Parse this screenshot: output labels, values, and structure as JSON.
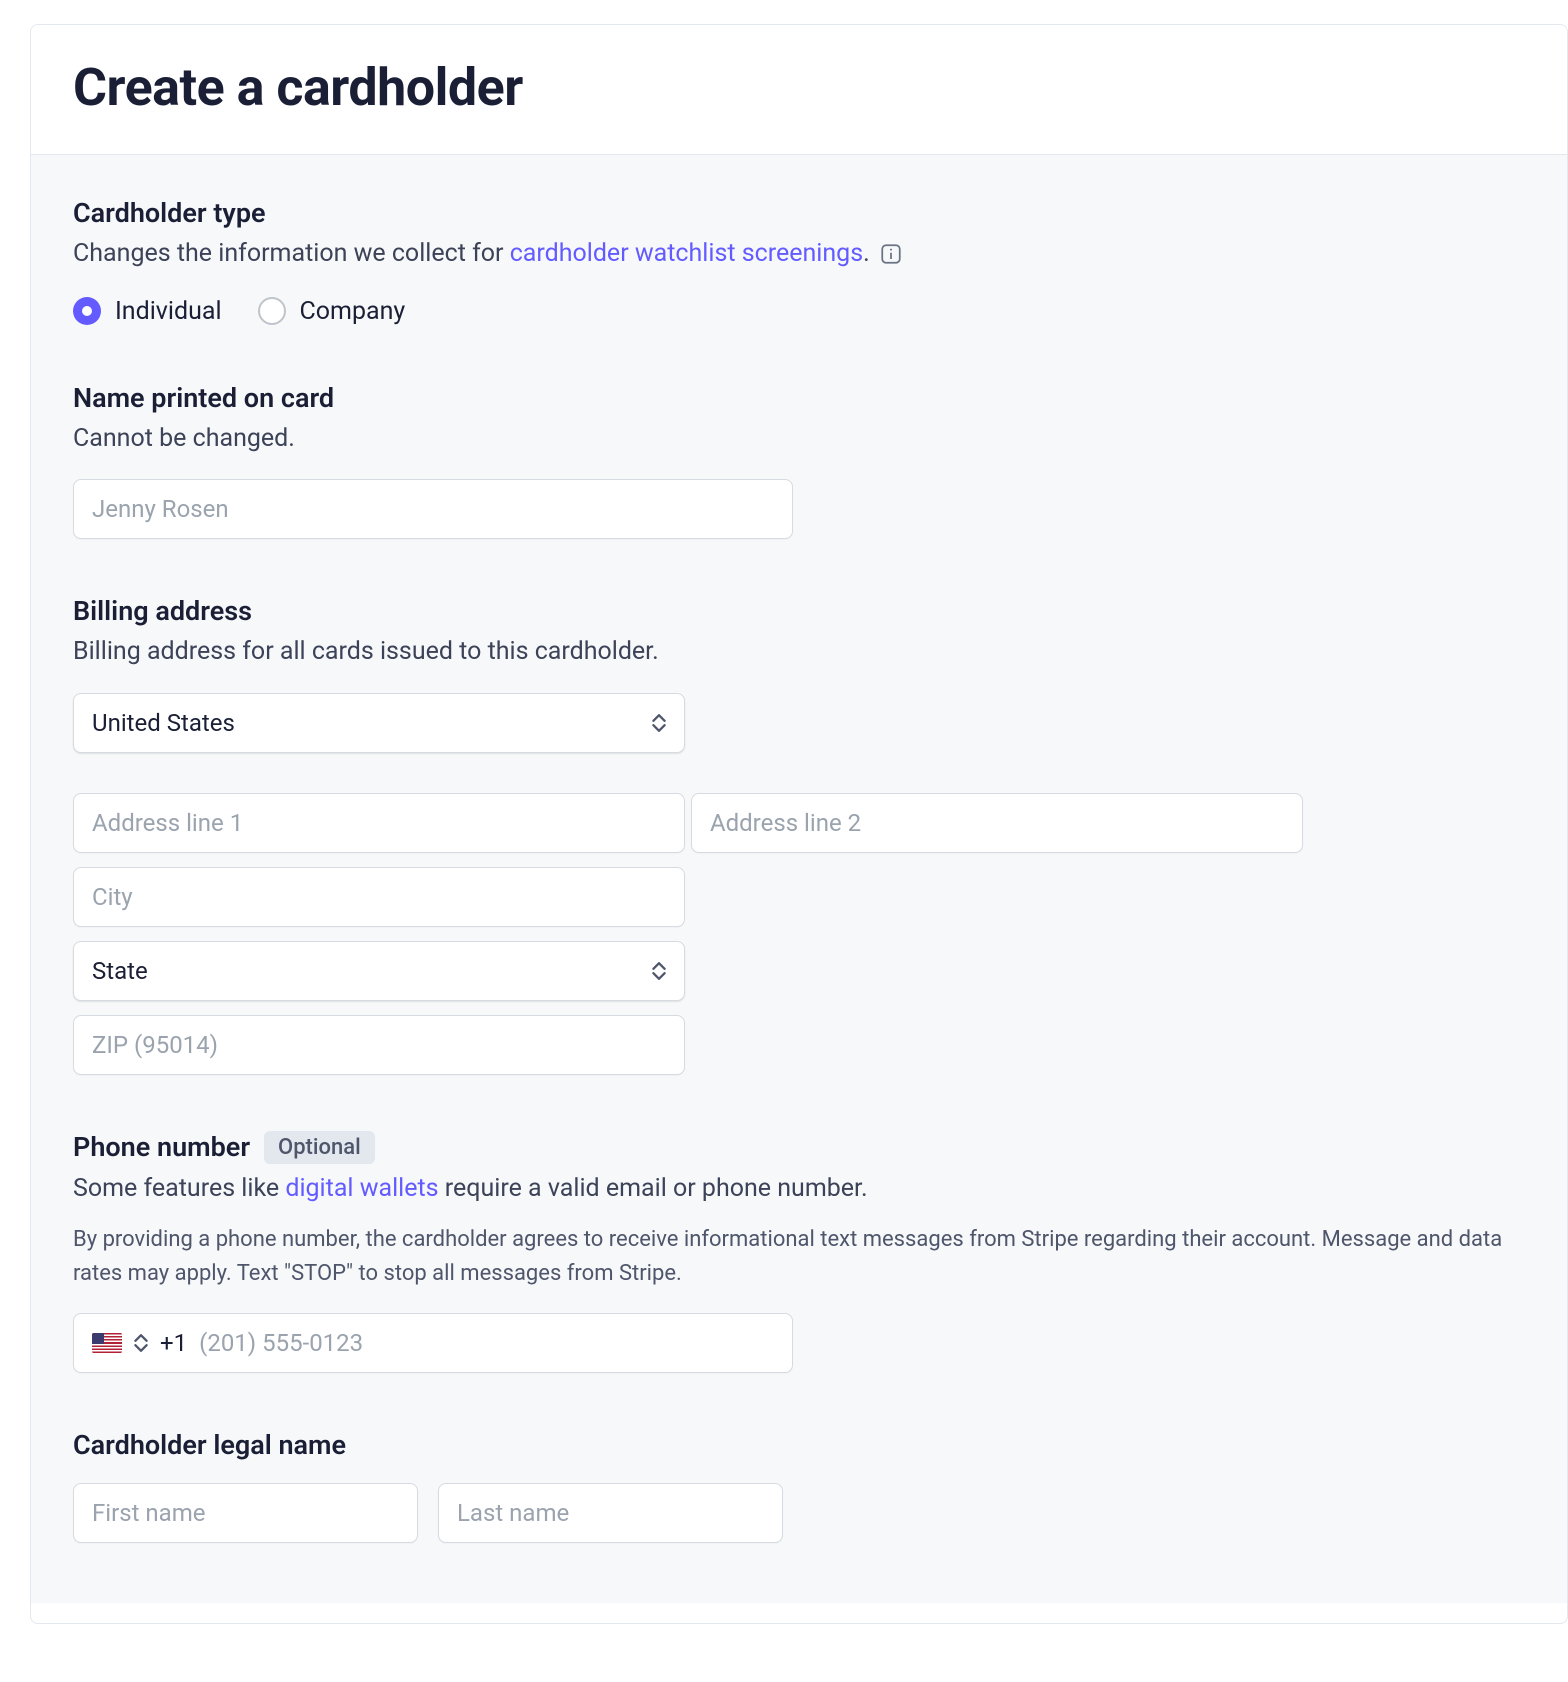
{
  "header": {
    "title": "Create a cardholder"
  },
  "cardholder_type": {
    "title": "Cardholder type",
    "subtitle_prefix": "Changes the information we collect for ",
    "subtitle_link": "cardholder watchlist screenings",
    "subtitle_suffix": ".",
    "options": {
      "individual": "Individual",
      "company": "Company"
    },
    "selected": "individual"
  },
  "name_on_card": {
    "title": "Name printed on card",
    "subtitle": "Cannot be changed.",
    "placeholder": "Jenny Rosen"
  },
  "billing": {
    "title": "Billing address",
    "subtitle": "Billing address for all cards issued to this cardholder.",
    "country": "United States",
    "address1_placeholder": "Address line 1",
    "address2_placeholder": "Address line 2",
    "city_placeholder": "City",
    "state": "State",
    "zip_placeholder": "ZIP (95014)"
  },
  "phone": {
    "title": "Phone number",
    "badge": "Optional",
    "subtitle_prefix": "Some features like ",
    "subtitle_link": "digital wallets",
    "subtitle_suffix": " require a valid email or phone number.",
    "fine_print": "By providing a phone number, the cardholder agrees to receive informational text messages from Stripe regarding their account. Message and data rates may apply. Text \"STOP\" to stop all messages from Stripe.",
    "country_code": "+1",
    "placeholder": "(201) 555-0123"
  },
  "legal_name": {
    "title": "Cardholder legal name",
    "first_placeholder": "First name",
    "last_placeholder": "Last name"
  }
}
